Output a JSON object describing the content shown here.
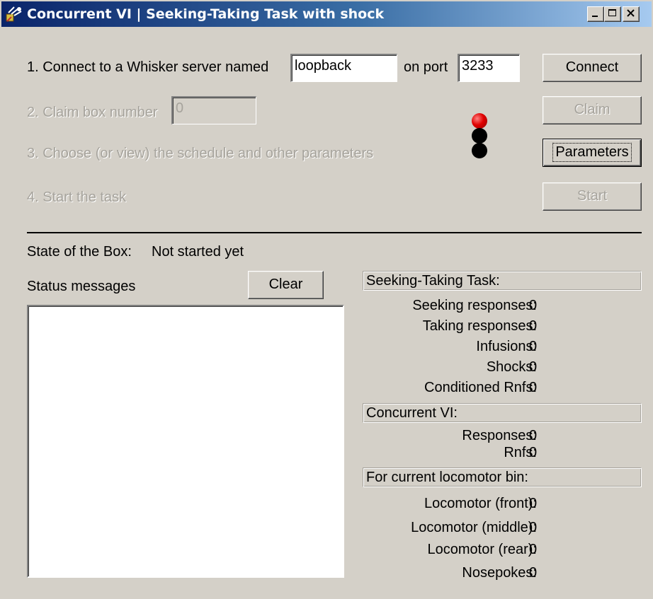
{
  "window": {
    "title": "Concurrent VI | Seeking-Taking Task with shock",
    "app_icon": "whisker-app-icon",
    "controls": [
      "minimize-icon",
      "maximize-icon",
      "close-icon"
    ]
  },
  "steps": {
    "step1_label": "1. Connect to a Whisker server named",
    "server_name": "loopback",
    "port_label": "on port",
    "port": "3233",
    "step2_label": "2. Claim box number",
    "box_number": "0",
    "step3_label": "3. Choose (or view) the schedule and other parameters",
    "step4_label": "4. Start the task"
  },
  "buttons": {
    "connect": "Connect",
    "claim": "Claim",
    "parameters": "Parameters",
    "start": "Start",
    "clear": "Clear"
  },
  "traffic_light": {
    "red": "#e00000",
    "off": "#000000",
    "active": "red"
  },
  "state": {
    "label": "State of the Box:",
    "value": "Not started yet"
  },
  "status_messages_label": "Status messages",
  "seeking_taking": {
    "header": "Seeking-Taking Task:",
    "rows": [
      {
        "label": "Seeking responses:",
        "value": "0"
      },
      {
        "label": "Taking responses:",
        "value": "0"
      },
      {
        "label": "Infusions:",
        "value": "0"
      },
      {
        "label": "Shocks:",
        "value": "0"
      },
      {
        "label": "Conditioned Rnfs:",
        "value": "0"
      }
    ]
  },
  "concurrent_vi": {
    "header": "Concurrent VI:",
    "rows": [
      {
        "label": "Responses:",
        "value": "0"
      },
      {
        "label": "Rnfs:",
        "value": "0"
      }
    ]
  },
  "locomotor": {
    "header": "For current locomotor bin:",
    "rows": [
      {
        "label": "Locomotor (front):",
        "value": "0"
      },
      {
        "label": "Locomotor (middle):",
        "value": "0"
      },
      {
        "label": "Locomotor (rear):",
        "value": "0"
      },
      {
        "label": "Nosepokes:",
        "value": "0"
      }
    ]
  }
}
